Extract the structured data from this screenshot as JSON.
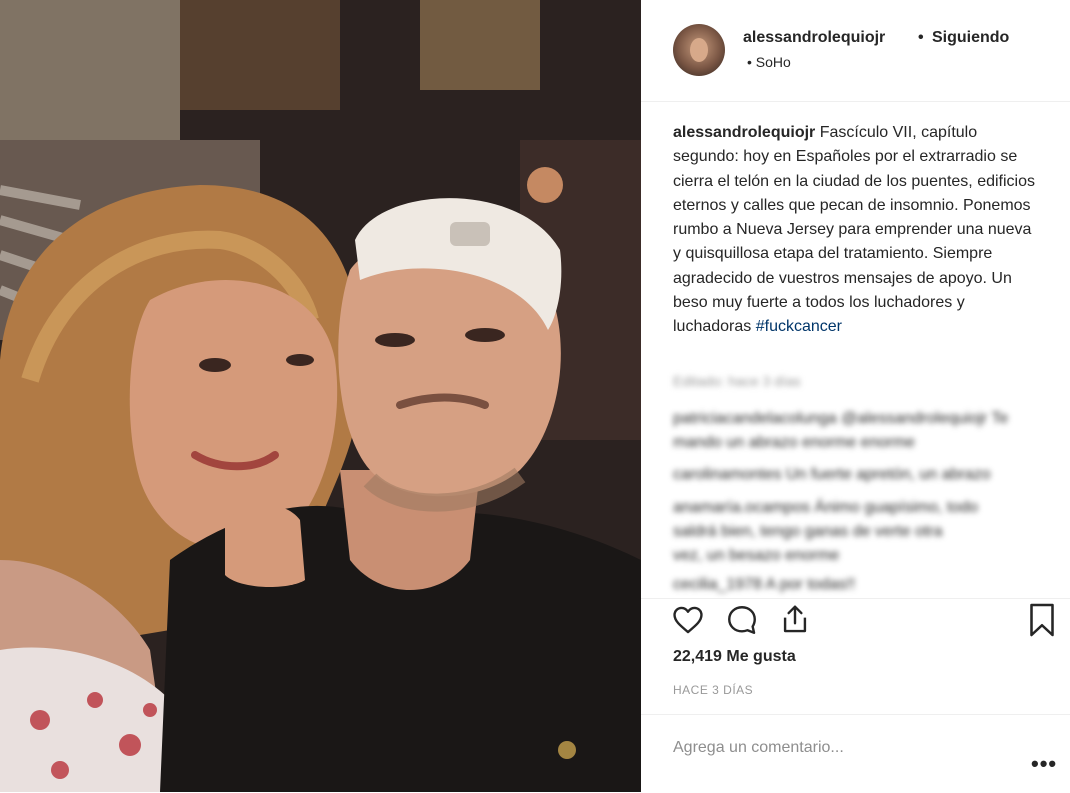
{
  "post": {
    "username": "alessandrolequiojr",
    "separator": "•",
    "follow_status": "Siguiendo",
    "location": "SoHo",
    "caption_user": "alessandrolequiojr",
    "caption_line1": " Fascículo VII, capítulo",
    "caption_rest": "segundo: hoy en Españoles por el extrarradio se cierra el telón en la ciudad de los puentes, edificios eternos y calles que pecan de insomnio. Ponemos rumbo a Nueva Jersey para emprender una nueva y quisquillosa etapa del tratamiento. Siempre agradecido de vuestros mensajes de apoyo. Un beso muy fuerte a todos los luchadores y luchadoras ",
    "hashtag": "#fuckcancer",
    "likes": "22,419 Me gusta",
    "time_ago": "HACE 3 DÍAS",
    "comment_placeholder": "Agrega un comentario...",
    "more_label": "•••"
  },
  "blurred_comments": [
    "Editado: hace 3 días",
    "patriciacandelacolunga @alessandrolequiojr Te",
    "mando un abrazo enorme enorme",
    "carolinamontes Un fuerte apretón, un abrazo",
    "anamaría.ocampos Ánimo guapísimo, todo",
    "saldrá bien, tengo ganas de verte otra",
    "vez, un besazo enorme",
    "cecilia_1978 A por todas!!"
  ],
  "icons": {
    "like": "heart-icon",
    "comment": "comment-bubble-icon",
    "share": "share-icon",
    "save": "bookmark-icon"
  },
  "colors": {
    "text": "#262626",
    "muted": "#999999",
    "hashtag": "#003569",
    "border": "#efefef"
  }
}
